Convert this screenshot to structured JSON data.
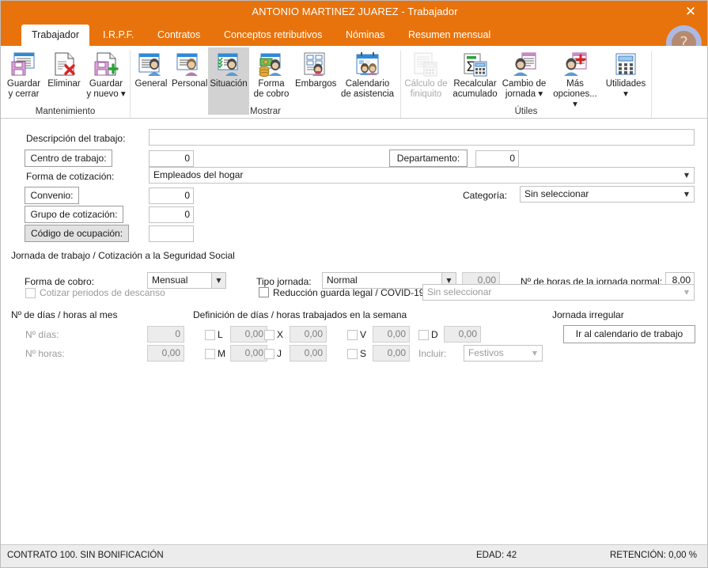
{
  "window": {
    "title": "ANTONIO MARTINEZ JUAREZ - Trabajador",
    "close_label": "✕",
    "accent_color": "#E8730C",
    "help_label": "?"
  },
  "tabs": [
    {
      "label": "Trabajador",
      "active": true
    },
    {
      "label": "I.R.P.F.",
      "active": false
    },
    {
      "label": "Contratos",
      "active": false
    },
    {
      "label": "Conceptos retributivos",
      "active": false
    },
    {
      "label": "Nóminas",
      "active": false
    },
    {
      "label": "Resumen mensual",
      "active": false
    }
  ],
  "ribbon": {
    "groups": [
      {
        "label": "Mantenimiento"
      },
      {
        "label": "Mostrar"
      },
      {
        "label": "Útiles"
      }
    ],
    "items": [
      {
        "label": "Guardar\ny cerrar",
        "icon": "save-close-icon",
        "state": "normal",
        "dropdown": false
      },
      {
        "label": "Eliminar",
        "icon": "delete-icon",
        "state": "normal",
        "dropdown": false
      },
      {
        "label": "Guardar\ny nuevo",
        "icon": "save-new-icon",
        "state": "normal",
        "dropdown": true
      },
      {
        "label": "General",
        "icon": "general-person-icon",
        "state": "normal",
        "dropdown": false
      },
      {
        "label": "Personal",
        "icon": "personal-person-icon",
        "state": "normal",
        "dropdown": false
      },
      {
        "label": "Situación",
        "icon": "situacion-person-icon",
        "state": "selected",
        "dropdown": false
      },
      {
        "label": "Forma\nde cobro",
        "icon": "payment-money-icon",
        "state": "normal",
        "dropdown": false
      },
      {
        "label": "Embargos",
        "icon": "embargos-doc-icon",
        "state": "normal",
        "dropdown": false
      },
      {
        "label": "Calendario\nde asistencia",
        "icon": "calendar-attendance-icon",
        "state": "normal",
        "dropdown": false
      },
      {
        "label": "Cálculo de\nfiniquito",
        "icon": "settlement-calc-icon",
        "state": "disabled",
        "dropdown": false
      },
      {
        "label": "Recalcular\nacumulado",
        "icon": "recalculate-sum-icon",
        "state": "normal",
        "dropdown": false
      },
      {
        "label": "Cambio de\njornada",
        "icon": "workday-change-icon",
        "state": "normal",
        "dropdown": true
      },
      {
        "label": "Más\nopciones...",
        "icon": "more-options-icon",
        "state": "normal",
        "dropdown": true
      },
      {
        "label": "Utilidades",
        "icon": "utilities-calculator-icon",
        "state": "normal",
        "dropdown": true
      }
    ]
  },
  "form": {
    "descripcion_label": "Descripción del trabajo:",
    "descripcion_value": "",
    "centro_label": "Centro de trabajo:",
    "centro_value": "0",
    "departamento_label": "Departamento:",
    "departamento_value": "0",
    "forma_cotizacion_label": "Forma de cotización:",
    "forma_cotizacion_value": "Empleados del hogar",
    "convenio_label": "Convenio:",
    "convenio_value": "0",
    "categoria_label": "Categoría:",
    "categoria_value": "Sin seleccionar",
    "grupo_cotizacion_label": "Grupo de cotización:",
    "grupo_cotizacion_value": "0",
    "codigo_ocupacion_label": "Código de ocupación:",
    "codigo_ocupacion_value": "",
    "jornada_section": "Jornada de trabajo / Cotización a la Seguridad Social",
    "forma_cobro_label": "Forma de cobro:",
    "forma_cobro_value": "Mensual",
    "tipo_jornada_label": "Tipo jornada:",
    "tipo_jornada_value": "Normal",
    "tipo_jornada_extra_value": "0,00",
    "horas_normal_label": "Nº de horas de la jornada normal:",
    "horas_normal_value": "8,00",
    "cotizar_descanso_label": "Cotizar periodos de descanso",
    "reduccion_label": "Reducción guarda legal / COVID-19",
    "reduccion_value": "Sin seleccionar",
    "dias_mes_section": "Nº de días / horas al mes",
    "n_dias_label": "Nº días:",
    "n_dias_value": "0",
    "n_horas_label": "Nº horas:",
    "n_horas_value": "0,00",
    "semana_section": "Definición de días / horas trabajados en la semana",
    "week_days": [
      {
        "code": "L",
        "value": "0,00"
      },
      {
        "code": "M",
        "value": "0,00"
      },
      {
        "code": "X",
        "value": "0,00"
      },
      {
        "code": "J",
        "value": "0,00"
      },
      {
        "code": "V",
        "value": "0,00"
      },
      {
        "code": "S",
        "value": "0,00"
      },
      {
        "code": "D",
        "value": "0,00"
      }
    ],
    "incluir_label": "Incluir:",
    "incluir_value": "Festivos",
    "jornada_irregular_section": "Jornada irregular",
    "ir_calendario_label": "Ir al calendario de trabajo"
  },
  "statusbar": {
    "contrato": "CONTRATO 100.  SIN BONIFICACIÓN",
    "edad": "EDAD: 42",
    "retencion": "RETENCIÓN: 0,00 %"
  }
}
